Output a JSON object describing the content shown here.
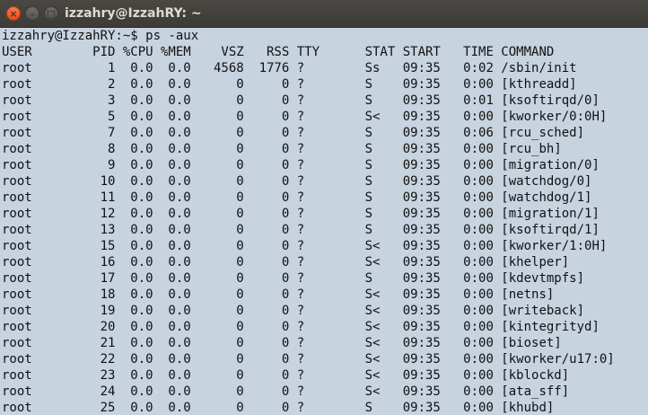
{
  "window": {
    "title": "izzahry@IzzahRY: ~",
    "buttons": {
      "close": "×",
      "minimize": "–",
      "maximize": "□"
    }
  },
  "terminal": {
    "prompt": "izzahry@IzzahRY:~$",
    "command": "ps -aux",
    "header": "USER        PID %CPU %MEM    VSZ   RSS TTY      STAT START   TIME COMMAND",
    "rows": [
      "root          1  0.0  0.0   4568  1776 ?        Ss   09:35   0:02 /sbin/init",
      "root          2  0.0  0.0      0     0 ?        S    09:35   0:00 [kthreadd]",
      "root          3  0.0  0.0      0     0 ?        S    09:35   0:01 [ksoftirqd/0]",
      "root          5  0.0  0.0      0     0 ?        S<   09:35   0:00 [kworker/0:0H]",
      "root          7  0.0  0.0      0     0 ?        S    09:35   0:06 [rcu_sched]",
      "root          8  0.0  0.0      0     0 ?        S    09:35   0:00 [rcu_bh]",
      "root          9  0.0  0.0      0     0 ?        S    09:35   0:00 [migration/0]",
      "root         10  0.0  0.0      0     0 ?        S    09:35   0:00 [watchdog/0]",
      "root         11  0.0  0.0      0     0 ?        S    09:35   0:00 [watchdog/1]",
      "root         12  0.0  0.0      0     0 ?        S    09:35   0:00 [migration/1]",
      "root         13  0.0  0.0      0     0 ?        S    09:35   0:00 [ksoftirqd/1]",
      "root         15  0.0  0.0      0     0 ?        S<   09:35   0:00 [kworker/1:0H]",
      "root         16  0.0  0.0      0     0 ?        S<   09:35   0:00 [khelper]",
      "root         17  0.0  0.0      0     0 ?        S    09:35   0:00 [kdevtmpfs]",
      "root         18  0.0  0.0      0     0 ?        S<   09:35   0:00 [netns]",
      "root         19  0.0  0.0      0     0 ?        S<   09:35   0:00 [writeback]",
      "root         20  0.0  0.0      0     0 ?        S<   09:35   0:00 [kintegrityd]",
      "root         21  0.0  0.0      0     0 ?        S<   09:35   0:00 [bioset]",
      "root         22  0.0  0.0      0     0 ?        S<   09:35   0:00 [kworker/u17:0]",
      "root         23  0.0  0.0      0     0 ?        S<   09:35   0:00 [kblockd]",
      "root         24  0.0  0.0      0     0 ?        S<   09:35   0:00 [ata_sff]",
      "root         25  0.0  0.0      0     0 ?        S    09:35   0:00 [khubd]"
    ]
  }
}
